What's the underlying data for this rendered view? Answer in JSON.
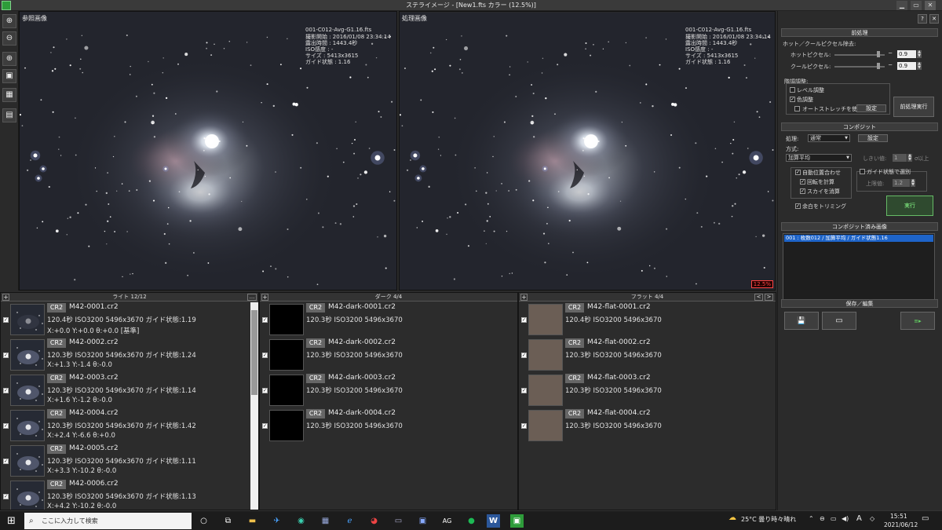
{
  "window": {
    "title": "ステライメージ - [New1.fts カラー (12.5%)]",
    "controls": {
      "help": "?",
      "close": "✕",
      "min": "▁",
      "max": "▭"
    }
  },
  "toolbar": {
    "buttons": [
      {
        "name": "zoom-in-icon",
        "glyph": "⊕"
      },
      {
        "name": "zoom-out-icon",
        "glyph": "⊖"
      },
      {
        "name": "zoom-fit-icon",
        "glyph": "⊕"
      },
      {
        "name": "fit-window-icon",
        "glyph": "▣"
      },
      {
        "name": "actual-size-icon",
        "glyph": "▦"
      },
      {
        "name": "compare-icon",
        "glyph": "▤"
      }
    ]
  },
  "view_left": {
    "label": "参照画像",
    "info": [
      "001-C012-Avg-G1.16.fts",
      "撮影開始 : 2016/01/08 23:34:14",
      "露出時間 : 1443.4秒",
      "ISO感度 : -",
      "サイズ : 5413x3615",
      "ガイド状態 : 1.16"
    ]
  },
  "view_right": {
    "label": "処理画像",
    "info": [
      "001-C012-Avg-G1.16.fts",
      "撮影開始 : 2016/01/08 23:34:14",
      "露出時間 : 1443.4秒",
      "ISO感度 : -",
      "サイズ : 5413x3615",
      "ガイド状態 : 1.16"
    ],
    "zoom": "12.5%"
  },
  "panel": {
    "preprocess": {
      "header": "前処理",
      "hotcool_title": "ホット／クールピクセル除去:",
      "hot_label": "ホットピクセル:",
      "hot_value": "0.9",
      "hot_level": 0.9,
      "cool_label": "クールピクセル:",
      "cool_value": "0.9",
      "cool_level": 0.9,
      "tone_title": "階調調整:",
      "level_label": "レベル調整",
      "color_label": "色調整",
      "autostretch_label": "オートストレッチを使う",
      "settings_label": "設定",
      "run_label": "前処理実行"
    },
    "composite": {
      "header": "コンポジット",
      "process_label": "処理:",
      "process_value": "通常",
      "settings_label": "設定",
      "method_label": "方式:",
      "method_value": "加算平均",
      "threshold_label": "しきい値:",
      "threshold_value": "1",
      "threshold_unit": "σ以上",
      "autoalign_label": "自動位置合わせ",
      "rotation_label": "回転を計算",
      "sky_label": "スカイを消算",
      "guide_select_label": "ガイド状態で選別",
      "upper_label": "上限値:",
      "upper_value": "1.2",
      "trim_label": "余白をトリミング",
      "run_label": "実行"
    },
    "composited": {
      "header": "コンポジット済み画像",
      "item": "001 : 枚数012 / 加算平均 / ガイド状態1.16"
    },
    "save": {
      "header": "保存／編集",
      "save_icon": "💾",
      "window_icon": "▭",
      "export_icon": "≡▸"
    }
  },
  "lights": {
    "header": "ライト 12/12",
    "plus": "+",
    "more": "...",
    "items": [
      {
        "badge": "CR2",
        "name": "M42-0001.cr2",
        "meta": "120.4秒 ISO3200 5496x3670 ガイド状態:1.19",
        "offset": "X:+0.0 Y:+0.0 θ:+0.0 [基準]"
      },
      {
        "badge": "CR2",
        "name": "M42-0002.cr2",
        "meta": "120.3秒 ISO3200 5496x3670 ガイド状態:1.24",
        "offset": "X:+1.3 Y:-1.4 θ:-0.0"
      },
      {
        "badge": "CR2",
        "name": "M42-0003.cr2",
        "meta": "120.3秒 ISO3200 5496x3670 ガイド状態:1.14",
        "offset": "X:+1.6 Y:-1.2 θ:-0.0"
      },
      {
        "badge": "CR2",
        "name": "M42-0004.cr2",
        "meta": "120.3秒 ISO3200 5496x3670 ガイド状態:1.42",
        "offset": "X:+2.4 Y:-6.6 θ:+0.0"
      },
      {
        "badge": "CR2",
        "name": "M42-0005.cr2",
        "meta": "120.3秒 ISO3200 5496x3670 ガイド状態:1.11",
        "offset": "X:+3.3 Y:-10.2 θ:-0.0"
      },
      {
        "badge": "CR2",
        "name": "M42-0006.cr2",
        "meta": "120.3秒 ISO3200 5496x3670 ガイド状態:1.13",
        "offset": "X:+4.2 Y:-10.2 θ:-0.0"
      }
    ]
  },
  "darks": {
    "header": "ダーク 4/4",
    "plus": "+",
    "items": [
      {
        "badge": "CR2",
        "name": "M42-dark-0001.cr2",
        "meta": "120.3秒 ISO3200 5496x3670"
      },
      {
        "badge": "CR2",
        "name": "M42-dark-0002.cr2",
        "meta": "120.3秒 ISO3200 5496x3670"
      },
      {
        "badge": "CR2",
        "name": "M42-dark-0003.cr2",
        "meta": "120.3秒 ISO3200 5496x3670"
      },
      {
        "badge": "CR2",
        "name": "M42-dark-0004.cr2",
        "meta": "120.3秒 ISO3200 5496x3670"
      }
    ]
  },
  "flats": {
    "header": "フラット 4/4",
    "plus": "+",
    "prev": "<",
    "next": ">",
    "items": [
      {
        "badge": "CR2",
        "name": "M42-flat-0001.cr2",
        "meta": "120.4秒 ISO3200 5496x3670"
      },
      {
        "badge": "CR2",
        "name": "M42-flat-0002.cr2",
        "meta": "120.3秒 ISO3200 5496x3670"
      },
      {
        "badge": "CR2",
        "name": "M42-flat-0003.cr2",
        "meta": "120.3秒 ISO3200 5496x3670"
      },
      {
        "badge": "CR2",
        "name": "M42-flat-0004.cr2",
        "meta": "120.3秒 ISO3200 5496x3670"
      }
    ]
  },
  "taskbar": {
    "search_placeholder": "ここに入力して検索",
    "weather": "25°C 曇り時々晴れ",
    "ime": "A",
    "time": "15:51",
    "date": "2021/06/12"
  }
}
